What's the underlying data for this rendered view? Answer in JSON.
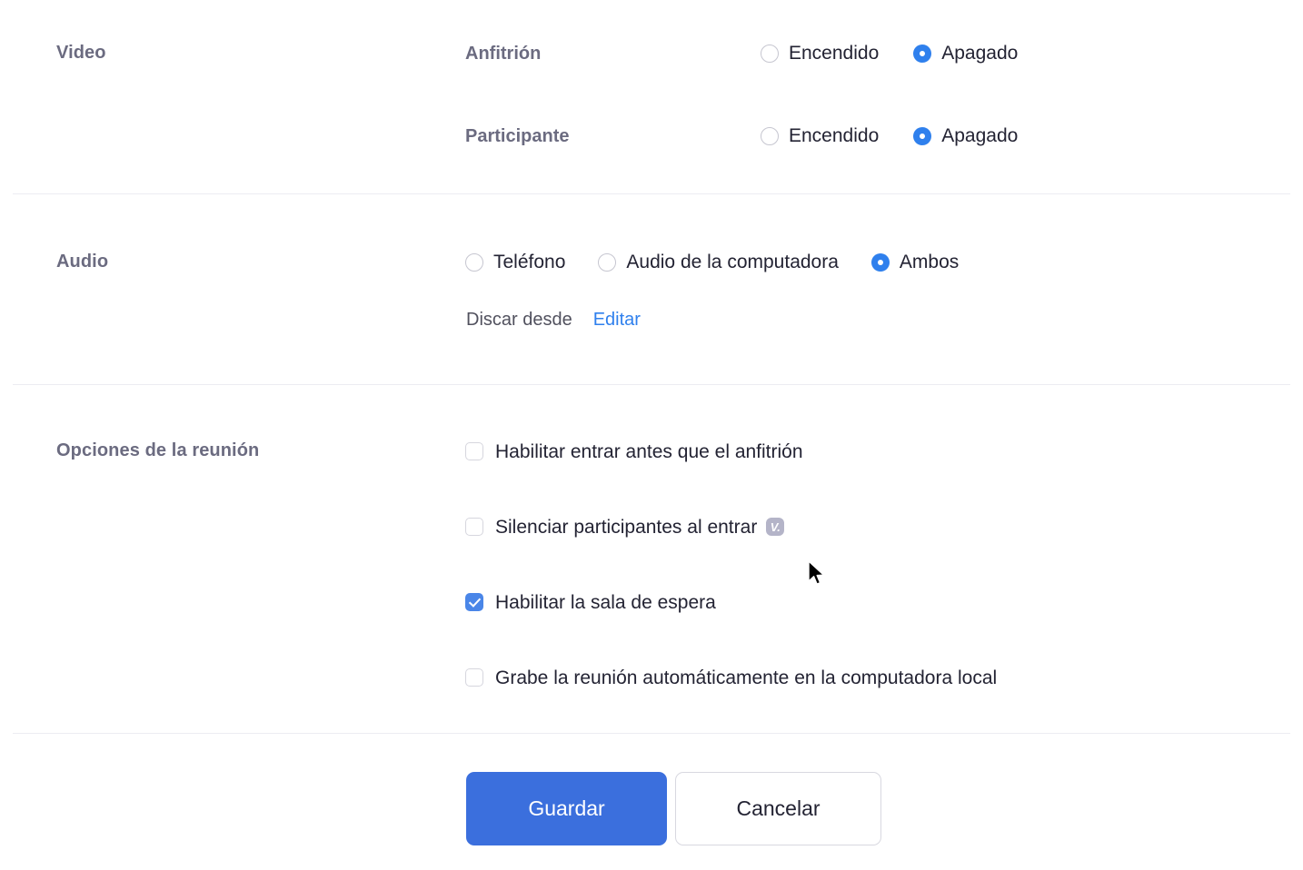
{
  "sections": {
    "video": {
      "label": "Video",
      "rows": [
        {
          "sub_label": "Anfitrión",
          "options": [
            {
              "label": "Encendido",
              "selected": false
            },
            {
              "label": "Apagado",
              "selected": true
            }
          ]
        },
        {
          "sub_label": "Participante",
          "options": [
            {
              "label": "Encendido",
              "selected": false
            },
            {
              "label": "Apagado",
              "selected": true
            }
          ]
        }
      ]
    },
    "audio": {
      "label": "Audio",
      "options": [
        {
          "label": "Teléfono",
          "selected": false
        },
        {
          "label": "Audio de la computadora",
          "selected": false
        },
        {
          "label": "Ambos",
          "selected": true
        }
      ],
      "dial_in_label": "Discar desde",
      "edit_link": "Editar"
    },
    "meeting_options": {
      "label": "Opciones de la reunión",
      "items": [
        {
          "label": "Habilitar entrar antes que el anfitrión",
          "checked": false,
          "has_help_badge": false,
          "badge_glyph": ""
        },
        {
          "label": "Silenciar participantes al entrar",
          "checked": false,
          "has_help_badge": true,
          "badge_glyph": "V."
        },
        {
          "label": "Habilitar la sala de espera",
          "checked": true,
          "has_help_badge": false,
          "badge_glyph": ""
        },
        {
          "label": "Grabe la reunión automáticamente en la computadora local",
          "checked": false,
          "has_help_badge": false,
          "badge_glyph": ""
        }
      ]
    }
  },
  "footer": {
    "save_label": "Guardar",
    "cancel_label": "Cancelar"
  },
  "colors": {
    "accent_blue": "#2f80ed",
    "button_blue": "#3b6fdd",
    "checkbox_blue": "#4a86e8",
    "label_grey": "#6b6b80",
    "text_dark": "#232333",
    "divider": "#ececf2",
    "badge_grey": "#b4b4c8"
  }
}
